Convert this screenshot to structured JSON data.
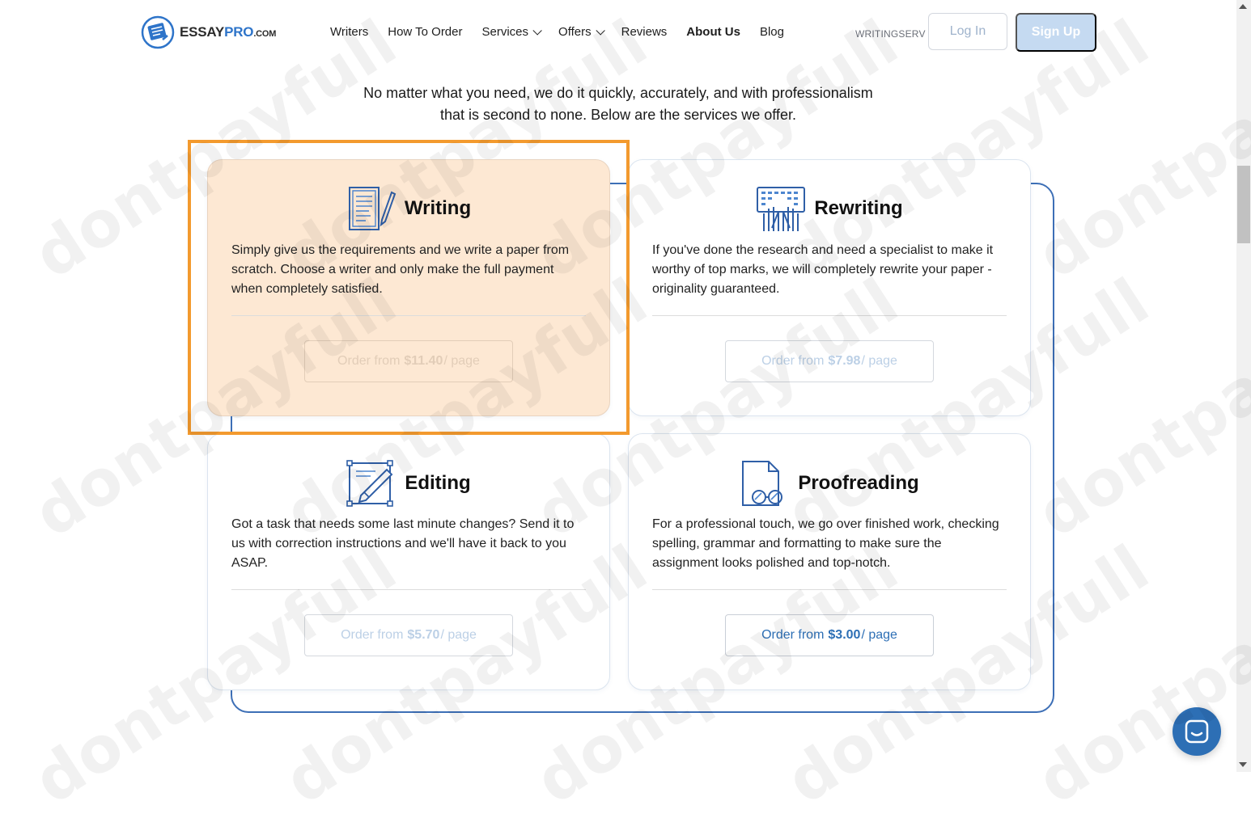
{
  "header": {
    "logo": {
      "essay": "ESSAY",
      "pro": "PRO",
      "com": ".COM"
    },
    "nav": [
      {
        "label": "Writers",
        "dropdown": false,
        "active": false
      },
      {
        "label": "How To Order",
        "dropdown": false,
        "active": false
      },
      {
        "label": "Services",
        "dropdown": true,
        "active": false
      },
      {
        "label": "Offers",
        "dropdown": true,
        "active": false
      },
      {
        "label": "Reviews",
        "dropdown": false,
        "active": false
      },
      {
        "label": "About Us",
        "dropdown": false,
        "active": true
      },
      {
        "label": "Blog",
        "dropdown": false,
        "active": false
      }
    ],
    "promo_code": "WRITINGSERV",
    "login_label": "Log In",
    "signup_label": "Sign Up"
  },
  "intro": {
    "line1": "No matter what you need, we do it quickly, accurately, and with professionalism",
    "line2": "that is second to none. Below are the services we offer."
  },
  "services": [
    {
      "title": "Writing",
      "description": "Simply give us the requirements and we write a paper from scratch. Choose a writer and only make the full payment when completely satisfied.",
      "order_prefix": "Order from",
      "price": "$11.40",
      "order_suffix": "/ page",
      "icon": "writing-doc-icon"
    },
    {
      "title": "Rewriting",
      "description": "If you've done the research and need a specialist to make it worthy of top marks, we will completely rewrite your paper - originality guaranteed.",
      "order_prefix": "Order from",
      "price": "$7.98",
      "order_suffix": "/ page",
      "icon": "keyboard-hands-icon"
    },
    {
      "title": "Editing",
      "description": "Got a task that needs some last minute changes? Send it to us with correction instructions and we'll have it back to you ASAP.",
      "order_prefix": "Order from",
      "price": "$5.70",
      "order_suffix": "/ page",
      "icon": "edit-pencil-icon"
    },
    {
      "title": "Proofreading",
      "description": "For a professional touch, we go over finished work, checking spelling, grammar and formatting to make sure the assignment looks polished and top-notch.",
      "order_prefix": "Order from",
      "price": "$3.00",
      "order_suffix": "/ page",
      "icon": "document-glasses-icon"
    }
  ],
  "watermark": "dontpayfull",
  "colors": {
    "brand_blue": "#2e74c9",
    "frame_blue": "#3d6fb6",
    "highlight_orange": "#f39a2e",
    "highlight_fill": "#fde8d3",
    "signup_bg": "#c5daf1"
  }
}
